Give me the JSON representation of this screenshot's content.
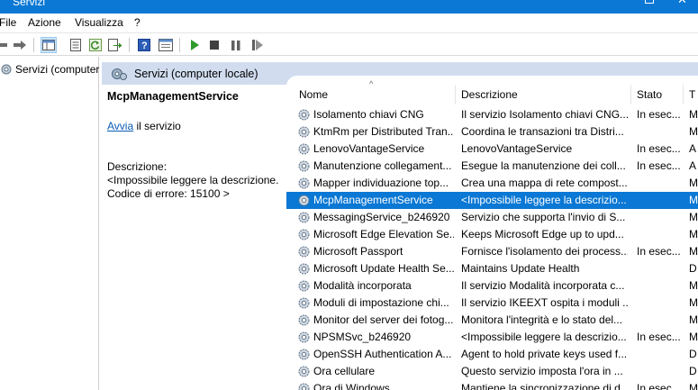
{
  "window": {
    "title": "Servizi"
  },
  "menu": [
    "File",
    "Azione",
    "Visualizza",
    "?"
  ],
  "tree": {
    "root_label": "Servizi (computer"
  },
  "panel": {
    "header": "Servizi (computer locale)"
  },
  "detail": {
    "service_name": "McpManagementService",
    "start_link": "Avvia",
    "start_suffix": " il servizio",
    "description_label": "Descrizione:",
    "description_text": "<Impossibile leggere la descrizione. Codice di errore: 15100 >"
  },
  "columns": [
    "Nome",
    "Descrizione",
    "Stato",
    "T"
  ],
  "rows": [
    {
      "name": "Isolamento chiavi CNG",
      "desc": "Il servizio Isolamento chiavi CNG...",
      "state": "In esec...",
      "type": "M"
    },
    {
      "name": "KtmRm per Distributed Tran...",
      "desc": "Coordina le transazioni tra Distri...",
      "state": "",
      "type": "M"
    },
    {
      "name": "LenovoVantageService",
      "desc": "LenovoVantageService",
      "state": "In esec...",
      "type": "A"
    },
    {
      "name": "Manutenzione collegament...",
      "desc": "Esegue la manutenzione dei coll...",
      "state": "In esec...",
      "type": "A"
    },
    {
      "name": "Mapper individuazione top...",
      "desc": "Crea una mappa di rete compost...",
      "state": "",
      "type": "M"
    },
    {
      "name": "McpManagementService",
      "desc": "<Impossibile leggere la descrizio...",
      "state": "",
      "type": "M",
      "selected": true
    },
    {
      "name": "MessagingService_b246920",
      "desc": "Servizio che supporta l'invio di S...",
      "state": "",
      "type": "M"
    },
    {
      "name": "Microsoft Edge Elevation Se...",
      "desc": "Keeps Microsoft Edge up to upd...",
      "state": "",
      "type": "M"
    },
    {
      "name": "Microsoft Passport",
      "desc": "Fornisce l'isolamento dei process...",
      "state": "In esec...",
      "type": "M"
    },
    {
      "name": "Microsoft Update Health Se...",
      "desc": "Maintains Update Health",
      "state": "",
      "type": "D"
    },
    {
      "name": "Modalità incorporata",
      "desc": "Il servizio Modalità incorporata c...",
      "state": "",
      "type": "M"
    },
    {
      "name": "Moduli di impostazione chi...",
      "desc": "Il servizio IKEEXT ospita i moduli ...",
      "state": "",
      "type": "M"
    },
    {
      "name": "Monitor del server dei fotog...",
      "desc": "Monitora l'integrità e lo stato del...",
      "state": "",
      "type": "M"
    },
    {
      "name": "NPSMSvc_b246920",
      "desc": "<Impossibile leggere la descrizio...",
      "state": "In esec...",
      "type": "M"
    },
    {
      "name": "OpenSSH Authentication A...",
      "desc": "Agent to hold private keys used f...",
      "state": "",
      "type": "D"
    },
    {
      "name": "Ora cellulare",
      "desc": "Questo servizio imposta l'ora in ...",
      "state": "",
      "type": "D"
    },
    {
      "name": "Ora di Windows",
      "desc": "Mantiene la sincronizzazione di d...",
      "state": "In esec...",
      "type": "M"
    }
  ],
  "colors": {
    "titlebar": "#0a78d4",
    "selection": "#0a78d4",
    "panel_header": "#d1ddef",
    "link": "#0a5bb5"
  },
  "toolbar_icons": [
    "back-arrow-icon",
    "forward-arrow-icon",
    "console-tree-icon",
    "properties-icon",
    "refresh-icon",
    "export-icon",
    "help-icon",
    "view-icon",
    "play-icon",
    "stop-icon",
    "pause-icon",
    "restart-icon"
  ]
}
